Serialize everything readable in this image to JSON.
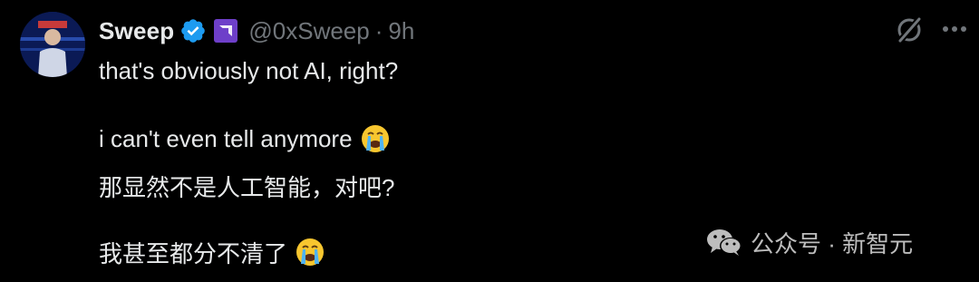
{
  "tweet": {
    "display_name": "Sweep",
    "handle": "@0xSweep",
    "separator": "·",
    "time": "9h",
    "lines": {
      "l1": "that's obviously not AI, right?",
      "l2": "i can't even tell anymore",
      "l3": "那显然不是人工智能，对吧?",
      "l4": "我甚至都分不清了"
    }
  },
  "watermark": {
    "text": "公众号 · 新智元"
  },
  "colors": {
    "background": "#000000",
    "text": "#e7e9ea",
    "muted": "#71767b",
    "verified": "#1d9bf0"
  },
  "icons": {
    "verified": "verified-badge-icon",
    "affiliate": "affiliate-logo-icon",
    "grok": "grok-icon",
    "more": "more-icon",
    "emoji": "loudly-crying-face-icon",
    "watermark": "wechat-logo-icon"
  }
}
